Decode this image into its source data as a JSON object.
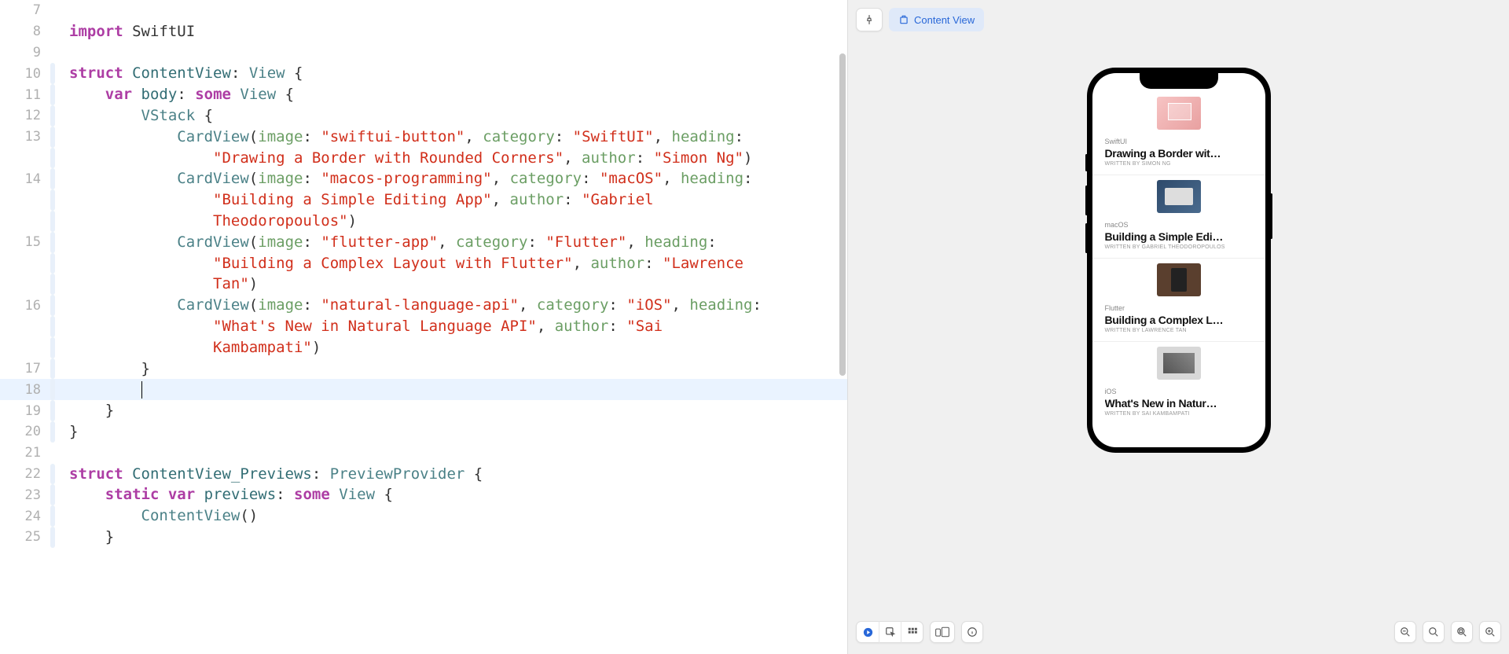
{
  "editor": {
    "lines": [
      {
        "num": 7,
        "changed": false,
        "html": ""
      },
      {
        "num": 8,
        "changed": false,
        "html": "<span class='tok-keyword'>import</span> SwiftUI"
      },
      {
        "num": 9,
        "changed": false,
        "html": ""
      },
      {
        "num": 10,
        "changed": true,
        "html": "<span class='tok-keyword'>struct</span> <span class='tok-decl'>ContentView</span>: <span class='tok-type'>View</span> {"
      },
      {
        "num": 11,
        "changed": true,
        "html": "    <span class='tok-keyword'>var</span> <span class='tok-var'>body</span>: <span class='tok-keyword'>some</span> <span class='tok-type'>View</span> {"
      },
      {
        "num": 12,
        "changed": true,
        "html": "        <span class='tok-type'>VStack</span> {"
      },
      {
        "num": 13,
        "changed": true,
        "html": "            <span class='tok-type'>CardView</span>(<span class='tok-param'>image</span>: <span class='tok-string'>\"swiftui-button\"</span>, <span class='tok-param'>category</span>: <span class='tok-string'>\"SwiftUI\"</span>, <span class='tok-param'>heading</span>:"
      },
      {
        "num": "",
        "changed": true,
        "html": "                <span class='tok-string'>\"Drawing a Border with Rounded Corners\"</span>, <span class='tok-param'>author</span>: <span class='tok-string'>\"Simon Ng\"</span>)"
      },
      {
        "num": 14,
        "changed": true,
        "html": "            <span class='tok-type'>CardView</span>(<span class='tok-param'>image</span>: <span class='tok-string'>\"macos-programming\"</span>, <span class='tok-param'>category</span>: <span class='tok-string'>\"macOS\"</span>, <span class='tok-param'>heading</span>:"
      },
      {
        "num": "",
        "changed": true,
        "html": "                <span class='tok-string'>\"Building a Simple Editing App\"</span>, <span class='tok-param'>author</span>: <span class='tok-string'>\"Gabriel</span>"
      },
      {
        "num": "",
        "changed": true,
        "html": "                <span class='tok-string'>Theodoropoulos\"</span>)"
      },
      {
        "num": 15,
        "changed": true,
        "html": "            <span class='tok-type'>CardView</span>(<span class='tok-param'>image</span>: <span class='tok-string'>\"flutter-app\"</span>, <span class='tok-param'>category</span>: <span class='tok-string'>\"Flutter\"</span>, <span class='tok-param'>heading</span>:"
      },
      {
        "num": "",
        "changed": true,
        "html": "                <span class='tok-string'>\"Building a Complex Layout with Flutter\"</span>, <span class='tok-param'>author</span>: <span class='tok-string'>\"Lawrence</span>"
      },
      {
        "num": "",
        "changed": true,
        "html": "                <span class='tok-string'>Tan\"</span>)"
      },
      {
        "num": 16,
        "changed": true,
        "html": "            <span class='tok-type'>CardView</span>(<span class='tok-param'>image</span>: <span class='tok-string'>\"natural-language-api\"</span>, <span class='tok-param'>category</span>: <span class='tok-string'>\"iOS\"</span>, <span class='tok-param'>heading</span>:"
      },
      {
        "num": "",
        "changed": true,
        "html": "                <span class='tok-string'>\"What's New in Natural Language API\"</span>, <span class='tok-param'>author</span>: <span class='tok-string'>\"Sai</span>"
      },
      {
        "num": "",
        "changed": true,
        "html": "                <span class='tok-string'>Kambampati\"</span>)"
      },
      {
        "num": 17,
        "changed": true,
        "html": "        }"
      },
      {
        "num": 18,
        "changed": true,
        "html": "        ",
        "cursor": true,
        "highlight": true
      },
      {
        "num": 19,
        "changed": true,
        "html": "    }"
      },
      {
        "num": 20,
        "changed": true,
        "html": "}"
      },
      {
        "num": 21,
        "changed": false,
        "html": ""
      },
      {
        "num": 22,
        "changed": true,
        "html": "<span class='tok-keyword'>struct</span> <span class='tok-decl'>ContentView_Previews</span>: <span class='tok-type'>PreviewProvider</span> {"
      },
      {
        "num": 23,
        "changed": true,
        "html": "    <span class='tok-keyword'>static</span> <span class='tok-keyword'>var</span> <span class='tok-var'>previews</span>: <span class='tok-keyword'>some</span> <span class='tok-type'>View</span> {"
      },
      {
        "num": 24,
        "changed": true,
        "html": "        <span class='tok-type'>ContentView</span>()"
      },
      {
        "num": 25,
        "changed": true,
        "html": "    }"
      }
    ]
  },
  "preview": {
    "chip_label": "Content View",
    "cards": [
      {
        "category": "SwiftUI",
        "heading": "Drawing a Border wit…",
        "author": "WRITTEN BY SIMON NG",
        "thumb": "thumb1"
      },
      {
        "category": "macOS",
        "heading": "Building a Simple Edi…",
        "author": "WRITTEN BY GABRIEL THEODOROPOULOS",
        "thumb": "thumb2"
      },
      {
        "category": "Flutter",
        "heading": "Building a Complex L…",
        "author": "WRITTEN BY LAWRENCE TAN",
        "thumb": "thumb3"
      },
      {
        "category": "iOS",
        "heading": "What's New in Natur…",
        "author": "WRITTEN BY SAI KAMBAMPATI",
        "thumb": "thumb4"
      }
    ]
  }
}
